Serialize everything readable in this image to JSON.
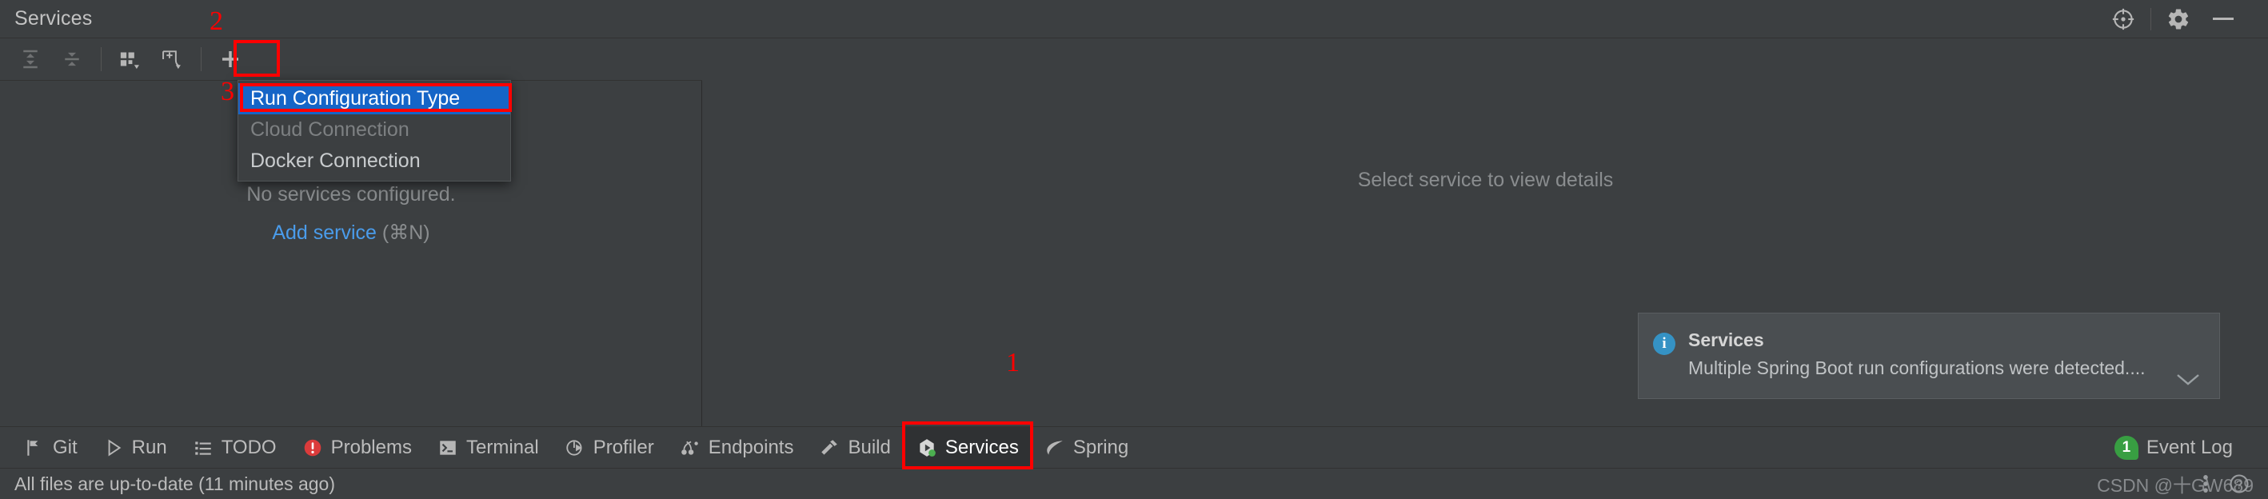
{
  "window": {
    "title": "Services",
    "controls": [
      {
        "name": "locate-icon",
        "glyph": "target"
      },
      {
        "name": "settings-icon",
        "glyph": "gear"
      },
      {
        "name": "minimize-icon",
        "glyph": "dash"
      }
    ]
  },
  "toolbar": {
    "buttons": [
      {
        "name": "expand-all-button",
        "label": "Expand All",
        "disabled": true
      },
      {
        "name": "collapse-all-button",
        "label": "Collapse All",
        "disabled": true
      },
      {
        "name": "group-by-button",
        "label": "Group By",
        "disabled": false
      },
      {
        "name": "add-tab-button",
        "label": "Add Tab",
        "disabled": false
      },
      {
        "name": "add-service-button",
        "label": "Add",
        "disabled": false
      }
    ]
  },
  "popup_menu": {
    "items": [
      {
        "label": "Run Configuration Type",
        "selected": true,
        "disabled": false
      },
      {
        "label": "Cloud Connection",
        "selected": false,
        "disabled": true
      },
      {
        "label": "Docker Connection",
        "selected": false,
        "disabled": false
      }
    ]
  },
  "tree_panel": {
    "empty_message": "No services configured.",
    "add_link": "Add service",
    "add_shortcut": "(⌘N)"
  },
  "details_panel": {
    "hint": "Select service to view details"
  },
  "notification": {
    "icon": "info-icon",
    "title": "Services",
    "message": "Multiple Spring Boot run configurations were detected....",
    "chevron": "⌄"
  },
  "bottom_bar": {
    "items": [
      {
        "label": "Git",
        "icon": "git-branch-icon",
        "active": false
      },
      {
        "label": "Run",
        "icon": "play-icon",
        "active": false
      },
      {
        "label": "TODO",
        "icon": "list-icon",
        "active": false
      },
      {
        "label": "Problems",
        "icon": "error-icon",
        "active": false
      },
      {
        "label": "Terminal",
        "icon": "terminal-icon",
        "active": false
      },
      {
        "label": "Profiler",
        "icon": "profiler-icon",
        "active": false
      },
      {
        "label": "Endpoints",
        "icon": "endpoints-icon",
        "active": false
      },
      {
        "label": "Build",
        "icon": "hammer-icon",
        "active": false
      },
      {
        "label": "Services",
        "icon": "services-icon",
        "active": true
      },
      {
        "label": "Spring",
        "icon": "spring-leaf-icon",
        "active": false
      }
    ],
    "event_log": {
      "label": "Event Log",
      "count": "1"
    }
  },
  "status_bar": {
    "message": "All files are up-to-date (11 minutes ago)",
    "watermark": "CSDN @十GW689"
  },
  "annotations": [
    {
      "number": "1"
    },
    {
      "number": "2"
    },
    {
      "number": "3"
    }
  ],
  "colors": {
    "accent_blue": "#1565c7",
    "link_blue": "#4a9ceb",
    "annotation_red": "#ff0000",
    "badge_green": "#389e42",
    "info_blue": "#3592c4",
    "background": "#3c3f41"
  }
}
